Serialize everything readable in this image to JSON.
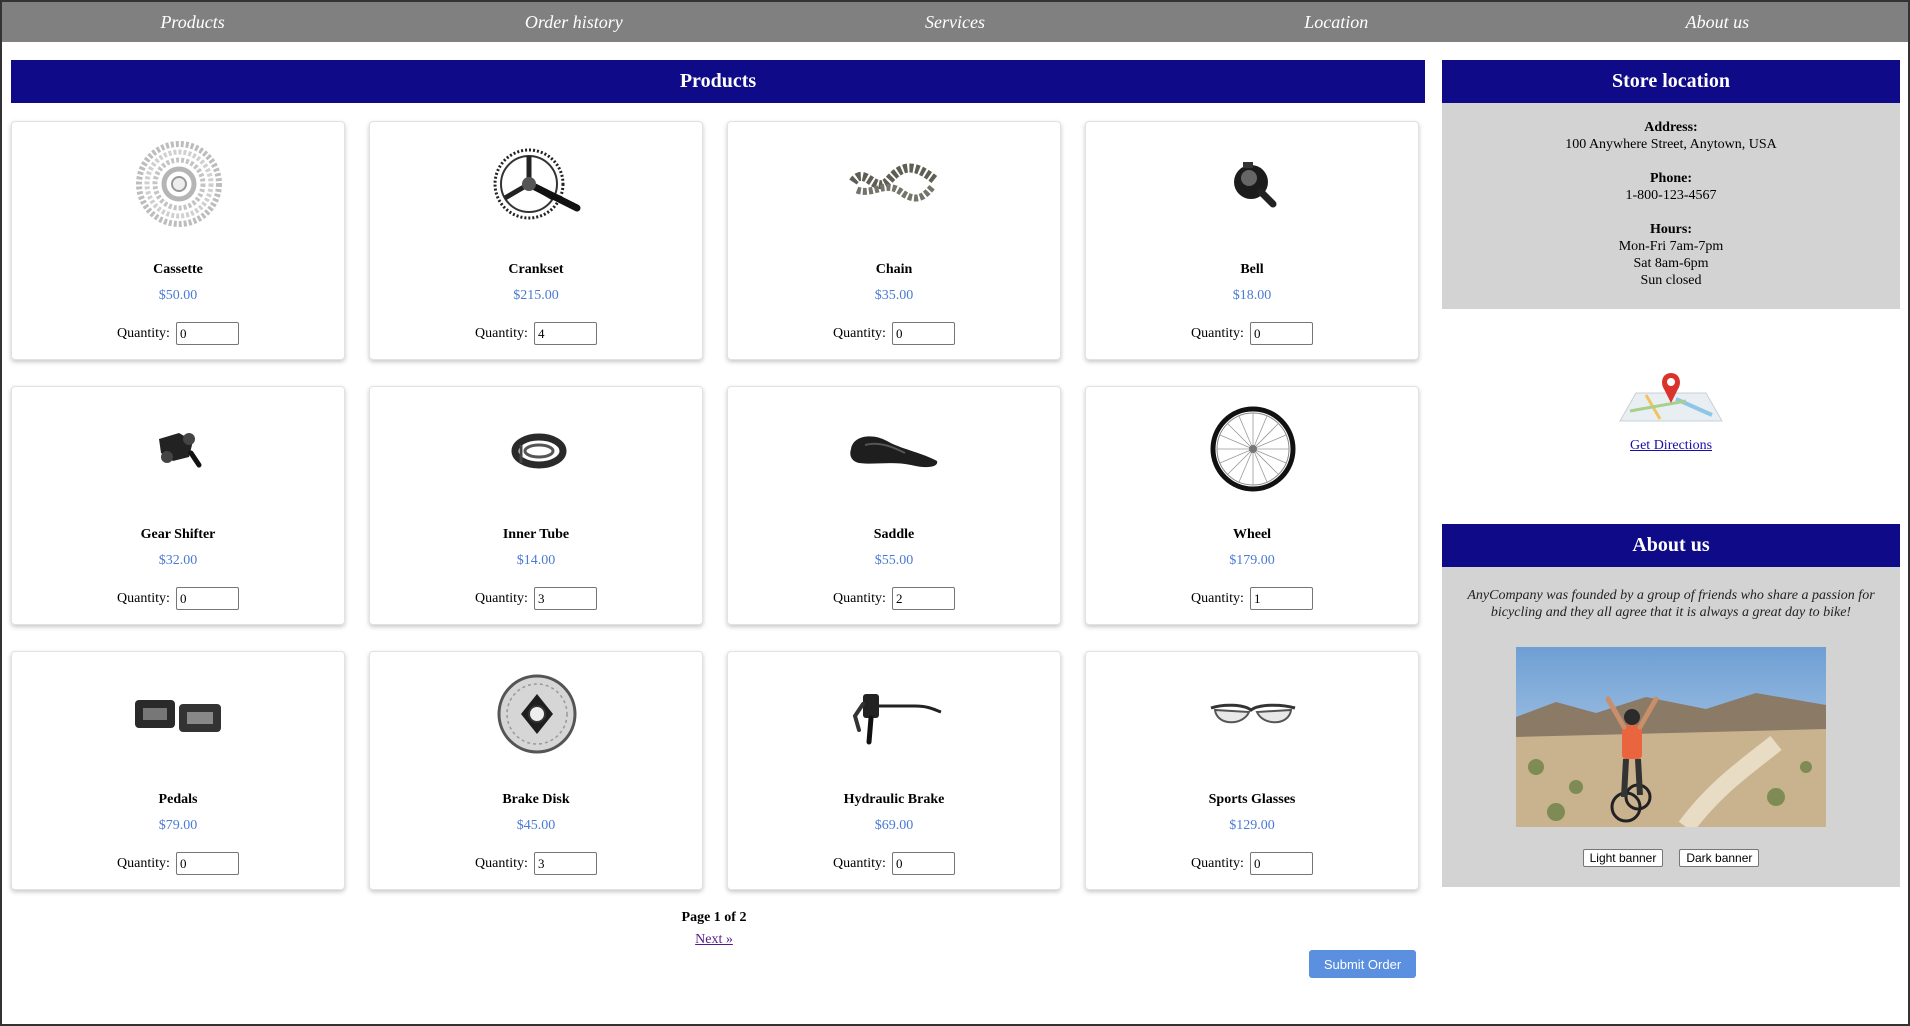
{
  "nav": {
    "items": [
      "Products",
      "Order history",
      "Services",
      "Location",
      "About us"
    ]
  },
  "products_section": {
    "title": "Products",
    "quantity_label": "Quantity:",
    "items": [
      {
        "name": "Cassette",
        "price": "$50.00",
        "qty": "0",
        "icon": "cassette-icon"
      },
      {
        "name": "Crankset",
        "price": "$215.00",
        "qty": "4",
        "icon": "crankset-icon"
      },
      {
        "name": "Chain",
        "price": "$35.00",
        "qty": "0",
        "icon": "chain-icon"
      },
      {
        "name": "Bell",
        "price": "$18.00",
        "qty": "0",
        "icon": "bell-icon"
      },
      {
        "name": "Gear Shifter",
        "price": "$32.00",
        "qty": "0",
        "icon": "gear-shifter-icon"
      },
      {
        "name": "Inner Tube",
        "price": "$14.00",
        "qty": "3",
        "icon": "inner-tube-icon"
      },
      {
        "name": "Saddle",
        "price": "$55.00",
        "qty": "2",
        "icon": "saddle-icon"
      },
      {
        "name": "Wheel",
        "price": "$179.00",
        "qty": "1",
        "icon": "wheel-icon"
      },
      {
        "name": "Pedals",
        "price": "$79.00",
        "qty": "0",
        "icon": "pedals-icon"
      },
      {
        "name": "Brake Disk",
        "price": "$45.00",
        "qty": "3",
        "icon": "brake-disk-icon"
      },
      {
        "name": "Hydraulic Brake",
        "price": "$69.00",
        "qty": "0",
        "icon": "hydraulic-brake-icon"
      },
      {
        "name": "Sports Glasses",
        "price": "$129.00",
        "qty": "0",
        "icon": "sports-glasses-icon"
      }
    ],
    "pager": {
      "label": "Page 1 of 2",
      "next": "Next »"
    },
    "submit_label": "Submit Order"
  },
  "store": {
    "title": "Store location",
    "address_label": "Address:",
    "address": "100 Anywhere Street, Anytown, USA",
    "phone_label": "Phone:",
    "phone": "1-800-123-4567",
    "hours_label": "Hours:",
    "hours": [
      "Mon-Fri 7am-7pm",
      "Sat 8am-6pm",
      "Sun closed"
    ],
    "directions_link": "Get Directions"
  },
  "about": {
    "title": "About us",
    "text": "AnyCompany was founded by a group of friends who share a passion for bicycling and they all agree that it is always a great day to bike!",
    "light_button": "Light banner",
    "dark_button": "Dark banner"
  },
  "colors": {
    "nav_bg": "#808080",
    "banner_bg": "#0f0a88",
    "price": "#4a7ad4",
    "submit_bg": "#5b8fe0",
    "panel_bg": "#d3d3d3"
  }
}
